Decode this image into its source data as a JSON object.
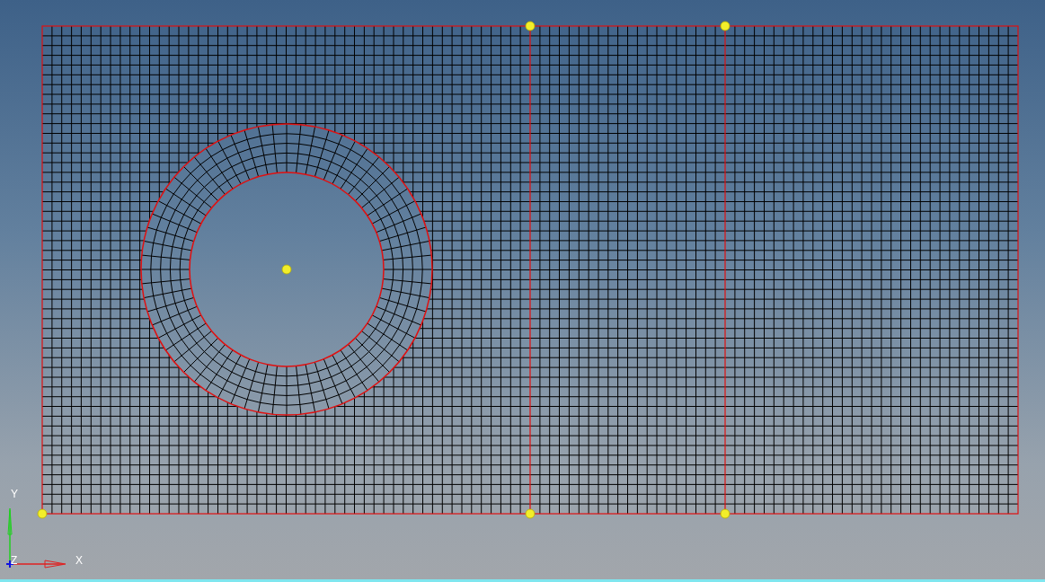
{
  "triad": {
    "labels": [
      {
        "kind": "y",
        "text": "Y"
      },
      {
        "kind": "z",
        "text": "Z"
      },
      {
        "kind": "x",
        "text": "X"
      }
    ]
  }
}
